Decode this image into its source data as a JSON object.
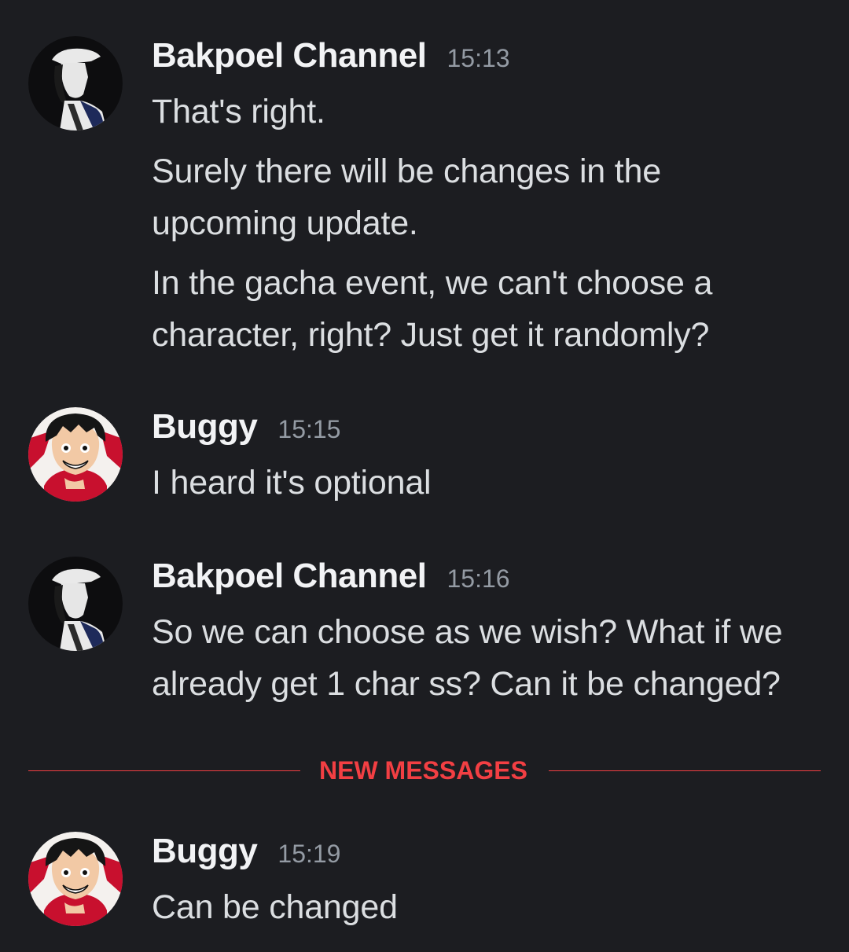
{
  "messages": [
    {
      "author": "Bakpoel Channel",
      "avatar": "hooded-figure-avatar",
      "time": "15:13",
      "lines": [
        "That's right.",
        "Surely there will be changes in the",
        "upcoming update.",
        "In the gacha event, we can't choose a",
        "character, right? Just get it randomly?"
      ]
    },
    {
      "author": "Buggy",
      "avatar": "anime-character-avatar",
      "time": "15:15",
      "lines": [
        "I heard it's optional"
      ]
    },
    {
      "author": "Bakpoel Channel",
      "avatar": "hooded-figure-avatar",
      "time": "15:16",
      "lines": [
        "So we can choose as we wish? What if we",
        "already get 1 char ss? Can it be changed?"
      ]
    },
    {
      "author": "Buggy",
      "avatar": "anime-character-avatar",
      "time": "15:19",
      "lines": [
        "Can be changed"
      ]
    }
  ],
  "divider": {
    "label": "NEW MESSAGES"
  },
  "colors": {
    "background": "#1c1d21",
    "username": "#f2f3f5",
    "timestamp": "#949ba4",
    "message_text": "#dbdee1",
    "new_messages_accent": "#f23f43"
  }
}
